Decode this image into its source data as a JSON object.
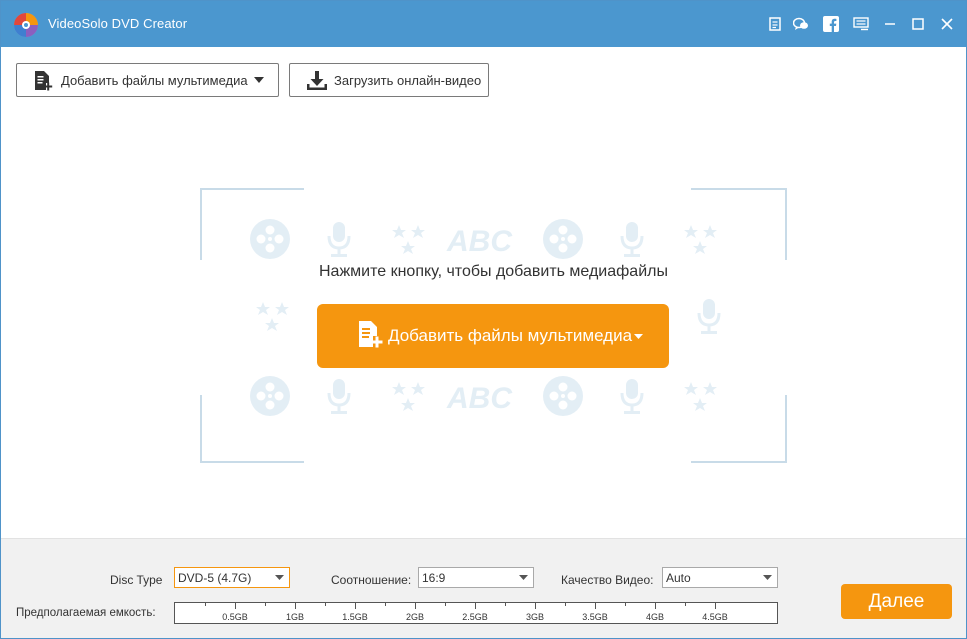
{
  "app": {
    "title": "VideoSolo DVD Creator"
  },
  "titlebar": {
    "icons": [
      "feedback-icon",
      "chat-icon",
      "facebook-icon",
      "menu-icon",
      "minimize-icon",
      "maximize-icon",
      "close-icon"
    ]
  },
  "toolbar": {
    "add_media_label": "Добавить файлы мультимедиа",
    "download_label": "Загрузить онлайн-видео"
  },
  "main": {
    "hint": "Нажмите кнопку, чтобы добавить медиафайлы",
    "add_button_label": "Добавить файлы мультимедиа",
    "pattern_text": "ABC"
  },
  "bottom": {
    "disc_type_label": "Disc Type",
    "disc_type_value": "DVD-5 (4.7G)",
    "aspect_label": "Соотношение:",
    "aspect_value": "16:9",
    "quality_label": "Качество Видео:",
    "quality_value": "Auto",
    "capacity_label": "Предполагаемая емкость:",
    "capacity_ticks": [
      "0.5GB",
      "1GB",
      "1.5GB",
      "2GB",
      "2.5GB",
      "3GB",
      "3.5GB",
      "4GB",
      "4.5GB"
    ],
    "next_label": "Далее"
  },
  "colors": {
    "titlebar": "#4b97cf",
    "accent_orange": "#f5960f",
    "pattern": "#e3eef5",
    "bottom_panel": "#f1f1f1"
  }
}
